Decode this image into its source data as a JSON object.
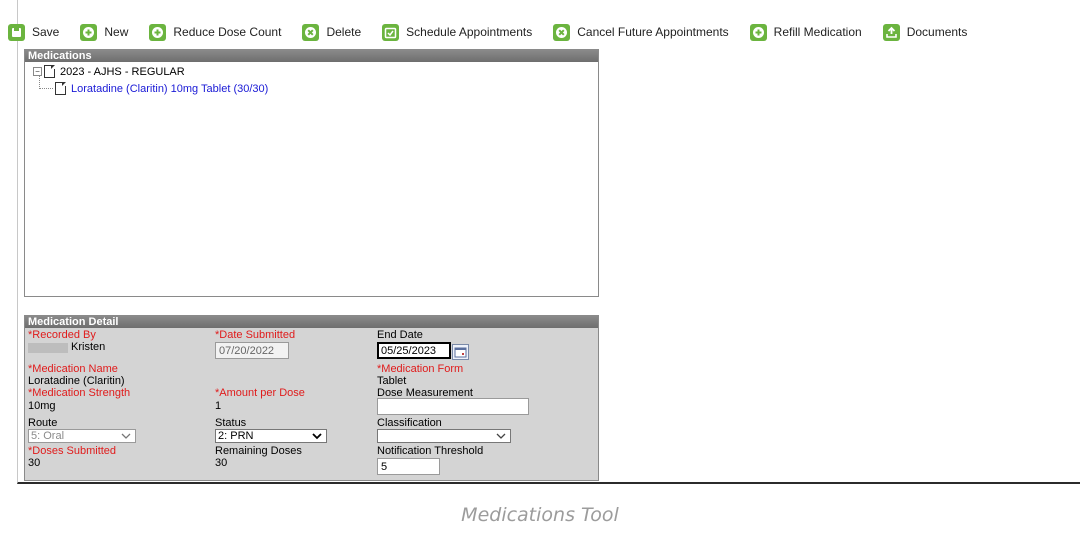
{
  "toolbar": {
    "buttons": [
      {
        "label": "Save",
        "icon": "save-icon"
      },
      {
        "label": "New",
        "icon": "plus-circle-icon"
      },
      {
        "label": "Reduce Dose Count",
        "icon": "plus-circle-icon"
      },
      {
        "label": "Delete",
        "icon": "x-circle-icon"
      },
      {
        "label": "Schedule Appointments",
        "icon": "calendar-check-icon"
      },
      {
        "label": "Cancel Future Appointments",
        "icon": "x-circle-icon"
      },
      {
        "label": "Refill Medication",
        "icon": "plus-circle-icon"
      },
      {
        "label": "Documents",
        "icon": "upload-icon"
      }
    ],
    "icon_color": "#6bb43f"
  },
  "tree": {
    "header": "Medications",
    "root_label": "2023 - AJHS - REGULAR",
    "child_label": "Loratadine (Claritin) 10mg Tablet (30/30)"
  },
  "detail": {
    "header": "Medication Detail",
    "recorded_by_label": "*Recorded By",
    "recorded_by_value": "Kristen",
    "date_submitted_label": "*Date Submitted",
    "date_submitted_value": "07/20/2022",
    "end_date_label": "End Date",
    "end_date_value": "05/25/2023",
    "medication_name_label": "*Medication Name",
    "medication_name_value": "Loratadine (Claritin)",
    "medication_form_label": "*Medication Form",
    "medication_form_value": "Tablet",
    "medication_strength_label": "*Medication Strength",
    "medication_strength_value": "10mg",
    "amount_per_dose_label": "*Amount per Dose",
    "amount_per_dose_value": "1",
    "dose_measurement_label": "Dose Measurement",
    "dose_measurement_value": "",
    "route_label": "Route",
    "route_value": "5: Oral",
    "status_label": "Status",
    "status_value": "2: PRN",
    "classification_label": "Classification",
    "classification_value": "",
    "doses_submitted_label": "*Doses Submitted",
    "doses_submitted_value": "30",
    "remaining_doses_label": "Remaining Doses",
    "remaining_doses_value": "30",
    "notification_threshold_label": "Notification Threshold",
    "notification_threshold_value": "5"
  },
  "caption": "Medications Tool",
  "colors": {
    "required_label": "#e01b1b",
    "link": "#1a1ad6",
    "panel_header": "#7a7a7a",
    "detail_bg": "#d4d4d4"
  }
}
